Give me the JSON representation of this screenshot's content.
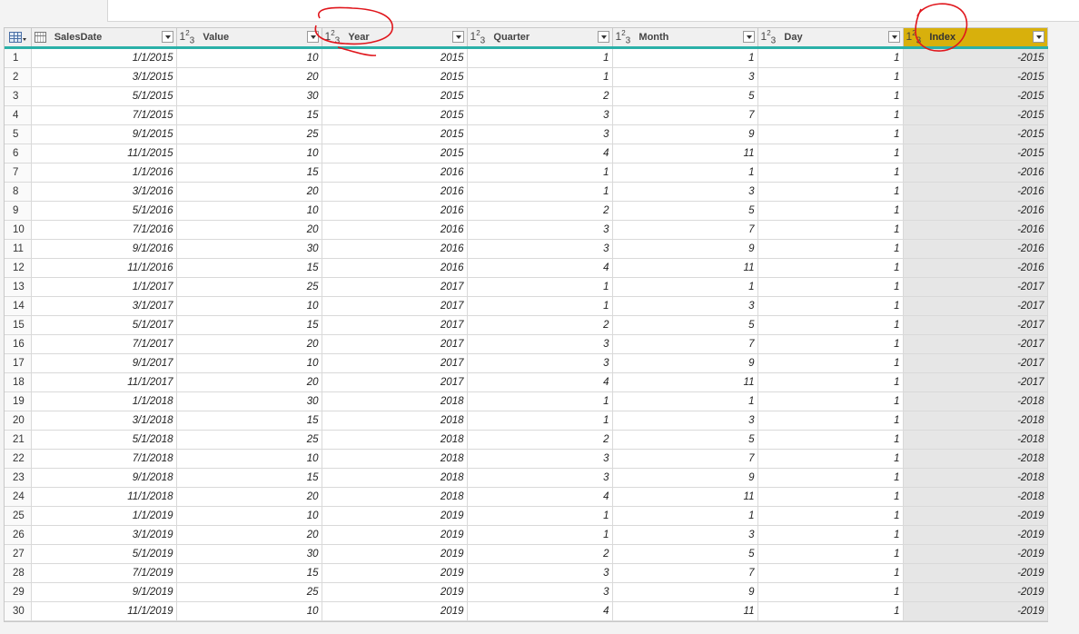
{
  "columns": [
    {
      "label": "SalesDate",
      "icon": "calendar-icon"
    },
    {
      "label": "Value",
      "icon": "whole-number-icon"
    },
    {
      "label": "Year",
      "icon": "whole-number-icon"
    },
    {
      "label": "Quarter",
      "icon": "whole-number-icon"
    },
    {
      "label": "Month",
      "icon": "whole-number-icon"
    },
    {
      "label": "Day",
      "icon": "whole-number-icon"
    },
    {
      "label": "Index",
      "icon": "whole-number-icon",
      "highlighted": true
    }
  ],
  "type_icon_text": {
    "base": "1",
    "sup": "2",
    "sub": "3"
  },
  "rows": [
    [
      "1",
      "1/1/2015",
      "10",
      "2015",
      "1",
      "1",
      "1",
      "-2015"
    ],
    [
      "2",
      "3/1/2015",
      "20",
      "2015",
      "1",
      "3",
      "1",
      "-2015"
    ],
    [
      "3",
      "5/1/2015",
      "30",
      "2015",
      "2",
      "5",
      "1",
      "-2015"
    ],
    [
      "4",
      "7/1/2015",
      "15",
      "2015",
      "3",
      "7",
      "1",
      "-2015"
    ],
    [
      "5",
      "9/1/2015",
      "25",
      "2015",
      "3",
      "9",
      "1",
      "-2015"
    ],
    [
      "6",
      "11/1/2015",
      "10",
      "2015",
      "4",
      "11",
      "1",
      "-2015"
    ],
    [
      "7",
      "1/1/2016",
      "15",
      "2016",
      "1",
      "1",
      "1",
      "-2016"
    ],
    [
      "8",
      "3/1/2016",
      "20",
      "2016",
      "1",
      "3",
      "1",
      "-2016"
    ],
    [
      "9",
      "5/1/2016",
      "10",
      "2016",
      "2",
      "5",
      "1",
      "-2016"
    ],
    [
      "10",
      "7/1/2016",
      "20",
      "2016",
      "3",
      "7",
      "1",
      "-2016"
    ],
    [
      "11",
      "9/1/2016",
      "30",
      "2016",
      "3",
      "9",
      "1",
      "-2016"
    ],
    [
      "12",
      "11/1/2016",
      "15",
      "2016",
      "4",
      "11",
      "1",
      "-2016"
    ],
    [
      "13",
      "1/1/2017",
      "25",
      "2017",
      "1",
      "1",
      "1",
      "-2017"
    ],
    [
      "14",
      "3/1/2017",
      "10",
      "2017",
      "1",
      "3",
      "1",
      "-2017"
    ],
    [
      "15",
      "5/1/2017",
      "15",
      "2017",
      "2",
      "5",
      "1",
      "-2017"
    ],
    [
      "16",
      "7/1/2017",
      "20",
      "2017",
      "3",
      "7",
      "1",
      "-2017"
    ],
    [
      "17",
      "9/1/2017",
      "10",
      "2017",
      "3",
      "9",
      "1",
      "-2017"
    ],
    [
      "18",
      "11/1/2017",
      "20",
      "2017",
      "4",
      "11",
      "1",
      "-2017"
    ],
    [
      "19",
      "1/1/2018",
      "30",
      "2018",
      "1",
      "1",
      "1",
      "-2018"
    ],
    [
      "20",
      "3/1/2018",
      "15",
      "2018",
      "1",
      "3",
      "1",
      "-2018"
    ],
    [
      "21",
      "5/1/2018",
      "25",
      "2018",
      "2",
      "5",
      "1",
      "-2018"
    ],
    [
      "22",
      "7/1/2018",
      "10",
      "2018",
      "3",
      "7",
      "1",
      "-2018"
    ],
    [
      "23",
      "9/1/2018",
      "15",
      "2018",
      "3",
      "9",
      "1",
      "-2018"
    ],
    [
      "24",
      "11/1/2018",
      "20",
      "2018",
      "4",
      "11",
      "1",
      "-2018"
    ],
    [
      "25",
      "1/1/2019",
      "10",
      "2019",
      "1",
      "1",
      "1",
      "-2019"
    ],
    [
      "26",
      "3/1/2019",
      "20",
      "2019",
      "1",
      "3",
      "1",
      "-2019"
    ],
    [
      "27",
      "5/1/2019",
      "30",
      "2019",
      "2",
      "5",
      "1",
      "-2019"
    ],
    [
      "28",
      "7/1/2019",
      "15",
      "2019",
      "3",
      "7",
      "1",
      "-2019"
    ],
    [
      "29",
      "9/1/2019",
      "25",
      "2019",
      "3",
      "9",
      "1",
      "-2019"
    ],
    [
      "30",
      "11/1/2019",
      "10",
      "2019",
      "4",
      "11",
      "1",
      "-2019"
    ]
  ],
  "colors": {
    "header_bg": "#f0f0f0",
    "highlight_header": "#d8b00c",
    "highlight_cells": "#e6e6e6",
    "quality_bar": "#2bb0a8",
    "annotation": "#e0161c"
  }
}
